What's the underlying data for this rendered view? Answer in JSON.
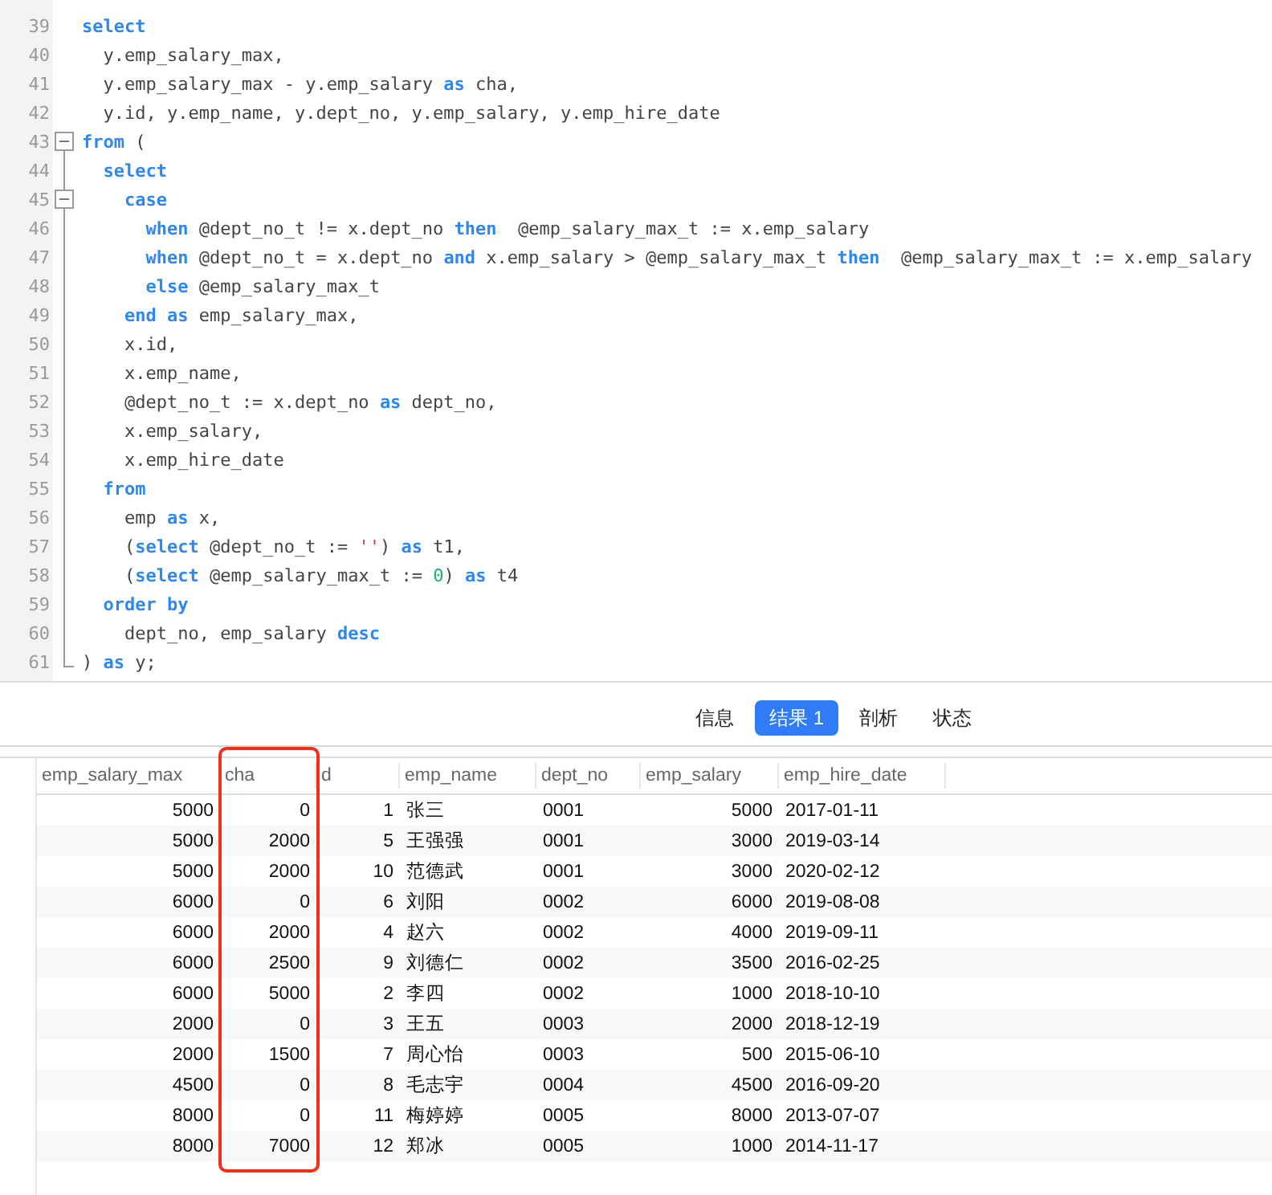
{
  "editor": {
    "lines": [
      {
        "number": "39",
        "foldable": false,
        "tokens": [
          {
            "kind": "keyword",
            "text": "select"
          }
        ]
      },
      {
        "number": "40",
        "foldable": false,
        "tokens": [
          {
            "kind": "plain",
            "text": "  y.emp_salary_max,"
          }
        ]
      },
      {
        "number": "41",
        "foldable": false,
        "tokens": [
          {
            "kind": "plain",
            "text": "  y.emp_salary_max - y.emp_salary "
          },
          {
            "kind": "keyword",
            "text": "as"
          },
          {
            "kind": "plain",
            "text": " cha,"
          }
        ]
      },
      {
        "number": "42",
        "foldable": false,
        "tokens": [
          {
            "kind": "plain",
            "text": "  y.id, y.emp_name, y.dept_no, y.emp_salary, y.emp_hire_date"
          }
        ]
      },
      {
        "number": "43",
        "foldable": true,
        "tokens": [
          {
            "kind": "keyword",
            "text": "from"
          },
          {
            "kind": "plain",
            "text": " ("
          }
        ]
      },
      {
        "number": "44",
        "foldable": false,
        "tokens": [
          {
            "kind": "keyword",
            "text": "  select"
          }
        ]
      },
      {
        "number": "45",
        "foldable": true,
        "tokens": [
          {
            "kind": "keyword",
            "text": "    case"
          }
        ]
      },
      {
        "number": "46",
        "foldable": false,
        "tokens": [
          {
            "kind": "keyword",
            "text": "      when"
          },
          {
            "kind": "plain",
            "text": " @dept_no_t != x.dept_no "
          },
          {
            "kind": "keyword",
            "text": "then"
          },
          {
            "kind": "plain",
            "text": "  @emp_salary_max_t := x.emp_salary"
          }
        ]
      },
      {
        "number": "47",
        "foldable": false,
        "tokens": [
          {
            "kind": "keyword",
            "text": "      when"
          },
          {
            "kind": "plain",
            "text": " @dept_no_t = x.dept_no "
          },
          {
            "kind": "keyword",
            "text": "and"
          },
          {
            "kind": "plain",
            "text": " x.emp_salary > @emp_salary_max_t "
          },
          {
            "kind": "keyword",
            "text": "then"
          },
          {
            "kind": "plain",
            "text": "  @emp_salary_max_t := x.emp_salary"
          }
        ]
      },
      {
        "number": "48",
        "foldable": false,
        "tokens": [
          {
            "kind": "keyword",
            "text": "      else"
          },
          {
            "kind": "plain",
            "text": " @emp_salary_max_t"
          }
        ]
      },
      {
        "number": "49",
        "foldable": false,
        "tokens": [
          {
            "kind": "keyword",
            "text": "    end as"
          },
          {
            "kind": "plain",
            "text": " emp_salary_max,"
          }
        ]
      },
      {
        "number": "50",
        "foldable": false,
        "tokens": [
          {
            "kind": "plain",
            "text": "    x.id,"
          }
        ]
      },
      {
        "number": "51",
        "foldable": false,
        "tokens": [
          {
            "kind": "plain",
            "text": "    x.emp_name,"
          }
        ]
      },
      {
        "number": "52",
        "foldable": false,
        "tokens": [
          {
            "kind": "plain",
            "text": "    @dept_no_t := x.dept_no "
          },
          {
            "kind": "keyword",
            "text": "as"
          },
          {
            "kind": "plain",
            "text": " dept_no,"
          }
        ]
      },
      {
        "number": "53",
        "foldable": false,
        "tokens": [
          {
            "kind": "plain",
            "text": "    x.emp_salary,"
          }
        ]
      },
      {
        "number": "54",
        "foldable": false,
        "tokens": [
          {
            "kind": "plain",
            "text": "    x.emp_hire_date"
          }
        ]
      },
      {
        "number": "55",
        "foldable": false,
        "tokens": [
          {
            "kind": "keyword",
            "text": "  from"
          }
        ]
      },
      {
        "number": "56",
        "foldable": false,
        "tokens": [
          {
            "kind": "plain",
            "text": "    emp "
          },
          {
            "kind": "keyword",
            "text": "as"
          },
          {
            "kind": "plain",
            "text": " x,"
          }
        ]
      },
      {
        "number": "57",
        "foldable": false,
        "tokens": [
          {
            "kind": "plain",
            "text": "    ("
          },
          {
            "kind": "keyword",
            "text": "select"
          },
          {
            "kind": "plain",
            "text": " @dept_no_t := "
          },
          {
            "kind": "string",
            "text": "''"
          },
          {
            "kind": "plain",
            "text": ") "
          },
          {
            "kind": "keyword",
            "text": "as"
          },
          {
            "kind": "plain",
            "text": " t1,"
          }
        ]
      },
      {
        "number": "58",
        "foldable": false,
        "tokens": [
          {
            "kind": "plain",
            "text": "    ("
          },
          {
            "kind": "keyword",
            "text": "select"
          },
          {
            "kind": "plain",
            "text": " @emp_salary_max_t := "
          },
          {
            "kind": "number",
            "text": "0"
          },
          {
            "kind": "plain",
            "text": ") "
          },
          {
            "kind": "keyword",
            "text": "as"
          },
          {
            "kind": "plain",
            "text": " t4"
          }
        ]
      },
      {
        "number": "59",
        "foldable": false,
        "tokens": [
          {
            "kind": "keyword",
            "text": "  order by"
          }
        ]
      },
      {
        "number": "60",
        "foldable": false,
        "tokens": [
          {
            "kind": "plain",
            "text": "    dept_no, emp_salary "
          },
          {
            "kind": "keyword",
            "text": "desc"
          }
        ]
      },
      {
        "number": "61",
        "foldable": false,
        "tokens": [
          {
            "kind": "plain",
            "text": ") "
          },
          {
            "kind": "keyword",
            "text": "as"
          },
          {
            "kind": "plain",
            "text": " y;"
          }
        ]
      }
    ]
  },
  "result_tabs": [
    {
      "label": "信息",
      "selected": false
    },
    {
      "label": "结果 1",
      "selected": true
    },
    {
      "label": "剖析",
      "selected": false
    },
    {
      "label": "状态",
      "selected": false
    }
  ],
  "table": {
    "columns": [
      {
        "label": "emp_salary_max",
        "kind": "numeric",
        "highlighted": false
      },
      {
        "label": "cha",
        "kind": "numeric",
        "highlighted": true
      },
      {
        "label": "d",
        "kind": "numeric",
        "highlighted": false
      },
      {
        "label": "emp_name",
        "kind": "text",
        "highlighted": false
      },
      {
        "label": "dept_no",
        "kind": "text",
        "highlighted": false
      },
      {
        "label": "emp_salary",
        "kind": "numeric",
        "highlighted": false
      },
      {
        "label": "emp_hire_date",
        "kind": "text",
        "highlighted": false
      }
    ],
    "rows": [
      [
        "5000",
        "0",
        "1",
        "张三",
        "0001",
        "5000",
        "2017-01-11"
      ],
      [
        "5000",
        "2000",
        "5",
        "王强强",
        "0001",
        "3000",
        "2019-03-14"
      ],
      [
        "5000",
        "2000",
        "10",
        "范德武",
        "0001",
        "3000",
        "2020-02-12"
      ],
      [
        "6000",
        "0",
        "6",
        "刘阳",
        "0002",
        "6000",
        "2019-08-08"
      ],
      [
        "6000",
        "2000",
        "4",
        "赵六",
        "0002",
        "4000",
        "2019-09-11"
      ],
      [
        "6000",
        "2500",
        "9",
        "刘德仁",
        "0002",
        "3500",
        "2016-02-25"
      ],
      [
        "6000",
        "5000",
        "2",
        "李四",
        "0002",
        "1000",
        "2018-10-10"
      ],
      [
        "2000",
        "0",
        "3",
        "王五",
        "0003",
        "2000",
        "2018-12-19"
      ],
      [
        "2000",
        "1500",
        "7",
        "周心怡",
        "0003",
        "500",
        "2015-06-10"
      ],
      [
        "4500",
        "0",
        "8",
        "毛志宇",
        "0004",
        "4500",
        "2016-09-20"
      ],
      [
        "8000",
        "0",
        "11",
        "梅婷婷",
        "0005",
        "8000",
        "2013-07-07"
      ],
      [
        "8000",
        "7000",
        "12",
        "郑冰",
        "0005",
        "1000",
        "2014-11-17"
      ]
    ]
  }
}
